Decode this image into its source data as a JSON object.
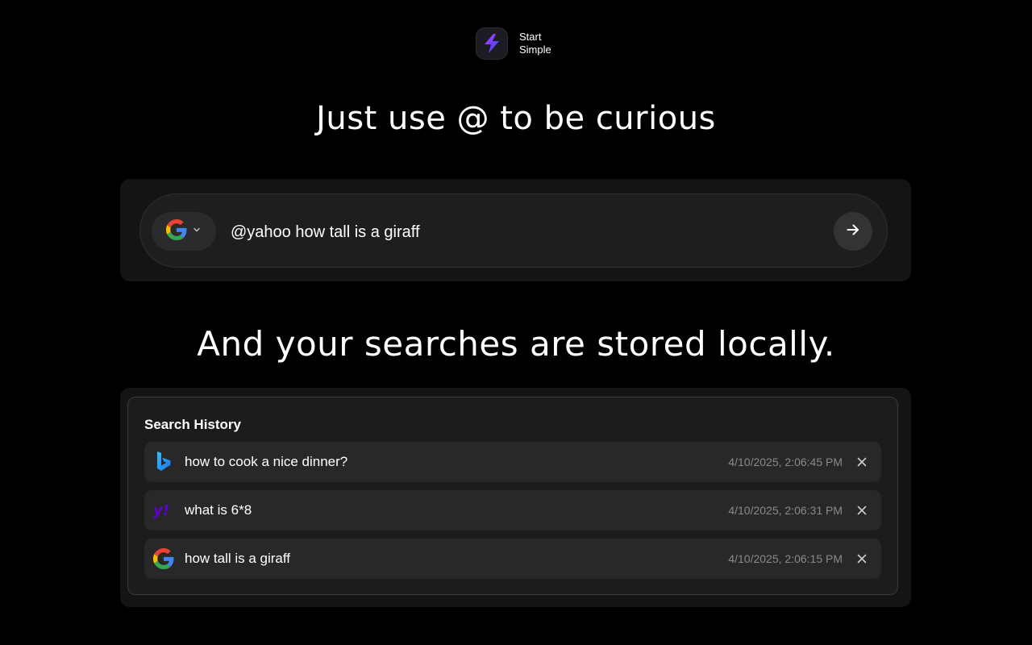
{
  "logo": {
    "line1": "Start",
    "line2": "Simple",
    "icon": "lightning-bolt-icon"
  },
  "headline_primary": "Just use @ to be curious",
  "headline_secondary": "And your searches are stored locally.",
  "search": {
    "engine": "google",
    "engine_icon": "google-icon",
    "dropdown_icon": "chevron-down-icon",
    "value": "@yahoo how tall is a giraff",
    "submit_icon": "arrow-right-icon"
  },
  "history": {
    "title": "Search History",
    "items": [
      {
        "engine": "bing",
        "icon": "bing-icon",
        "query": "how to cook a nice dinner?",
        "time": "4/10/2025, 2:06:45 PM"
      },
      {
        "engine": "yahoo",
        "icon": "yahoo-icon",
        "query": "what is 6*8",
        "time": "4/10/2025, 2:06:31 PM"
      },
      {
        "engine": "google",
        "icon": "google-icon",
        "query": "how tall is a giraff",
        "time": "4/10/2025, 2:06:15 PM"
      }
    ],
    "remove_icon": "close-icon"
  },
  "colors": {
    "background": "#000000",
    "panel": "#141414",
    "search_bar": "#1e1e1e",
    "item": "#282828",
    "timestamp": "#8a8a8a",
    "yahoo": "#6001d2",
    "bing": "#1aa3e8"
  }
}
